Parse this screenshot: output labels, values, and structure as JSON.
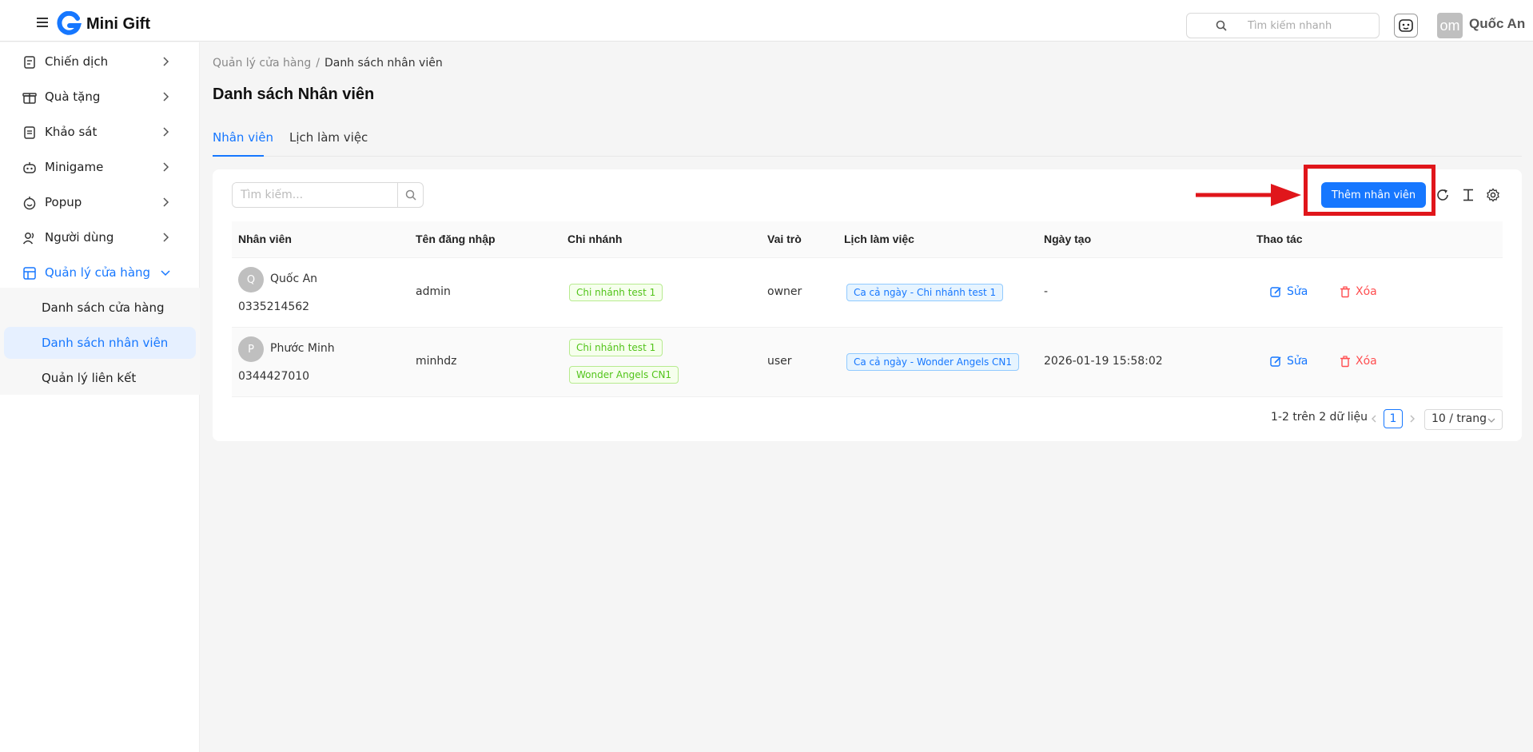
{
  "app": {
    "title": "Mini Gift"
  },
  "header": {
    "search_placeholder": "Tìm kiếm nhanh",
    "avatar_initials": "om",
    "user_name": "Quốc An"
  },
  "sidebar": {
    "items": [
      {
        "label": "Chiến dịch",
        "icon": "campaign-icon"
      },
      {
        "label": "Quà tặng",
        "icon": "gift-icon"
      },
      {
        "label": "Khảo sát",
        "icon": "survey-icon"
      },
      {
        "label": "Minigame",
        "icon": "game-icon"
      },
      {
        "label": "Popup",
        "icon": "popup-icon"
      },
      {
        "label": "Người dùng",
        "icon": "users-icon"
      },
      {
        "label": "Quản lý cửa hàng",
        "icon": "store-icon"
      }
    ],
    "sub_items": [
      {
        "label": "Danh sách cửa hàng"
      },
      {
        "label": "Danh sách nhân viên"
      },
      {
        "label": "Quản lý liên kết"
      }
    ]
  },
  "breadcrumb": {
    "parent": "Quản lý cửa hàng",
    "separator": "/",
    "current": "Danh sách nhân viên"
  },
  "page_title": "Danh sách Nhân viên",
  "tabs": [
    {
      "label": "Nhân viên"
    },
    {
      "label": "Lịch làm việc"
    }
  ],
  "toolbar": {
    "search_placeholder": "Tìm kiếm...",
    "add_label": "Thêm nhân viên"
  },
  "table": {
    "columns": [
      "Nhân viên",
      "Tên đăng nhập",
      "Chi nhánh",
      "Vai trò",
      "Lịch làm việc",
      "Ngày tạo",
      "Thao tác"
    ],
    "rows": [
      {
        "avatar": "Q",
        "name": "Quốc An",
        "phone": "0335214562",
        "username": "admin",
        "branches": [
          "Chi nhánh test 1"
        ],
        "role": "owner",
        "schedule": "Ca cả ngày - Chi nhánh test 1",
        "created": "-",
        "edit": "Sửa",
        "delete": "Xóa"
      },
      {
        "avatar": "P",
        "name": "Phước Minh",
        "phone": "0344427010",
        "username": "minhdz",
        "branches": [
          "Chi nhánh test 1",
          "Wonder Angels CN1"
        ],
        "role": "user",
        "schedule": "Ca cả ngày - Wonder Angels CN1",
        "created": "2026-01-19 15:58:02",
        "edit": "Sửa",
        "delete": "Xóa"
      }
    ]
  },
  "pagination": {
    "summary": "1-2 trên 2 dữ liệu",
    "current_page": "1",
    "page_size": "10 / trang"
  },
  "colors": {
    "primary": "#1677ff",
    "danger": "#ff4d4f",
    "highlight": "#e0161b",
    "tag_green": "#52c41a"
  }
}
